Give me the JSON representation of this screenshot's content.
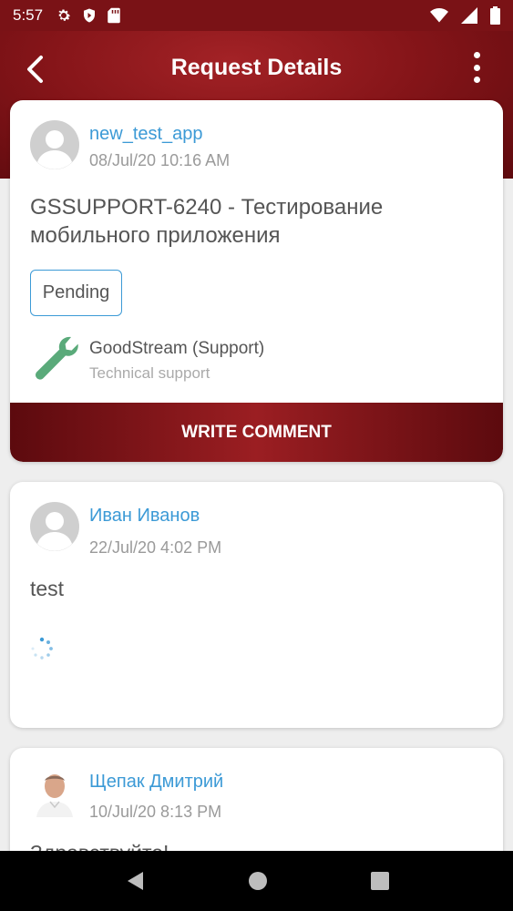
{
  "status_bar": {
    "time": "5:57"
  },
  "app_bar": {
    "title": "Request Details"
  },
  "request": {
    "author": "new_test_app",
    "date": "08/Jul/20 10:16 AM",
    "title": "GSSUPPORT-6240 - Тестирование мобильного приложения",
    "status": "Pending",
    "service_name": "GoodStream (Support)",
    "service_category": "Technical support",
    "service_icon": "wrench-icon",
    "write_comment_label": "WRITE COMMENT"
  },
  "comments": [
    {
      "author": "Иван Иванов",
      "date": "22/Jul/20 4:02 PM",
      "text": "test"
    },
    {
      "author": "Щепак Дмитрий",
      "date": "10/Jul/20 8:13 PM",
      "text": "Здравствуйте!"
    }
  ],
  "colors": {
    "brand_dark": "#6a0e12",
    "brand": "#9b1e22",
    "link_blue": "#3c9ad6",
    "icon_green": "#5aaa7a"
  }
}
